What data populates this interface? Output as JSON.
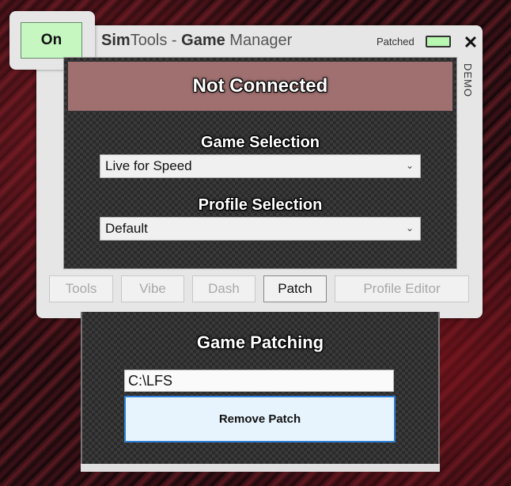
{
  "window": {
    "on_label": "On",
    "title_part1": "Sim",
    "title_part2": "Tools - ",
    "title_part3": "Game",
    "title_part4": " Manager",
    "patched_label": "Patched",
    "close_label": "✕",
    "demo_label": "DEMO"
  },
  "status": {
    "text": "Not Connected"
  },
  "game_selection": {
    "label": "Game Selection",
    "value": "Live for Speed"
  },
  "profile_selection": {
    "label": "Profile Selection",
    "value": "Default"
  },
  "tabs": [
    {
      "label": "Tools"
    },
    {
      "label": "Vibe"
    },
    {
      "label": "Dash"
    },
    {
      "label": "Patch"
    },
    {
      "label": "Profile Editor"
    }
  ],
  "patching": {
    "title": "Game Patching",
    "path": "C:\\LFS",
    "remove_label": "Remove Patch"
  },
  "colors": {
    "on_button": "#c6f7c0",
    "status_bar": "#a07070",
    "remove_button_border": "#2f7fd8"
  }
}
